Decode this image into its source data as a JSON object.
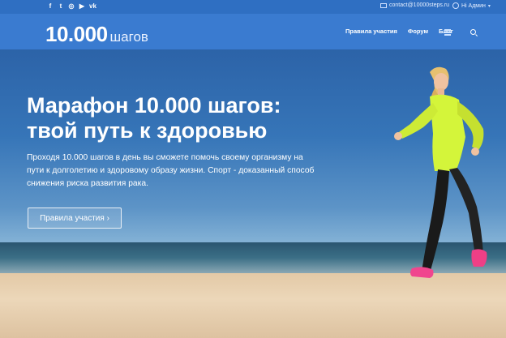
{
  "topbar": {
    "social": [
      {
        "icon": "facebook-icon",
        "glyph": "f"
      },
      {
        "icon": "twitter-icon",
        "glyph": "t"
      },
      {
        "icon": "instagram-icon",
        "glyph": "◎"
      },
      {
        "icon": "youtube-icon",
        "glyph": "▶"
      },
      {
        "icon": "vk-icon",
        "glyph": "vk"
      }
    ],
    "email": "contact@10000steps.ru",
    "user": "Hi Админ"
  },
  "header": {
    "logo_number": "10.000",
    "logo_word": "шагов",
    "nav": [
      "Правила участия",
      "Форум",
      "Блог"
    ]
  },
  "hero": {
    "title_line1": "Марафон 10.000 шагов:",
    "title_line2": "твой путь к здоровью",
    "text_line1": "Проходя 10.000 шагов в день вы сможете помочь своему организму на",
    "text_line2": "пути к долголетию и здоровому образу жизни. Спорт - доказанный способ",
    "text_line3": "снижения риска развития рака.",
    "cta_label": "Правила участия ›"
  },
  "colors": {
    "topbar_bg": "#2f6fc2",
    "header_bg": "#3a7bd0",
    "jacket": "#d4f53a",
    "shoes": "#f0468e"
  }
}
